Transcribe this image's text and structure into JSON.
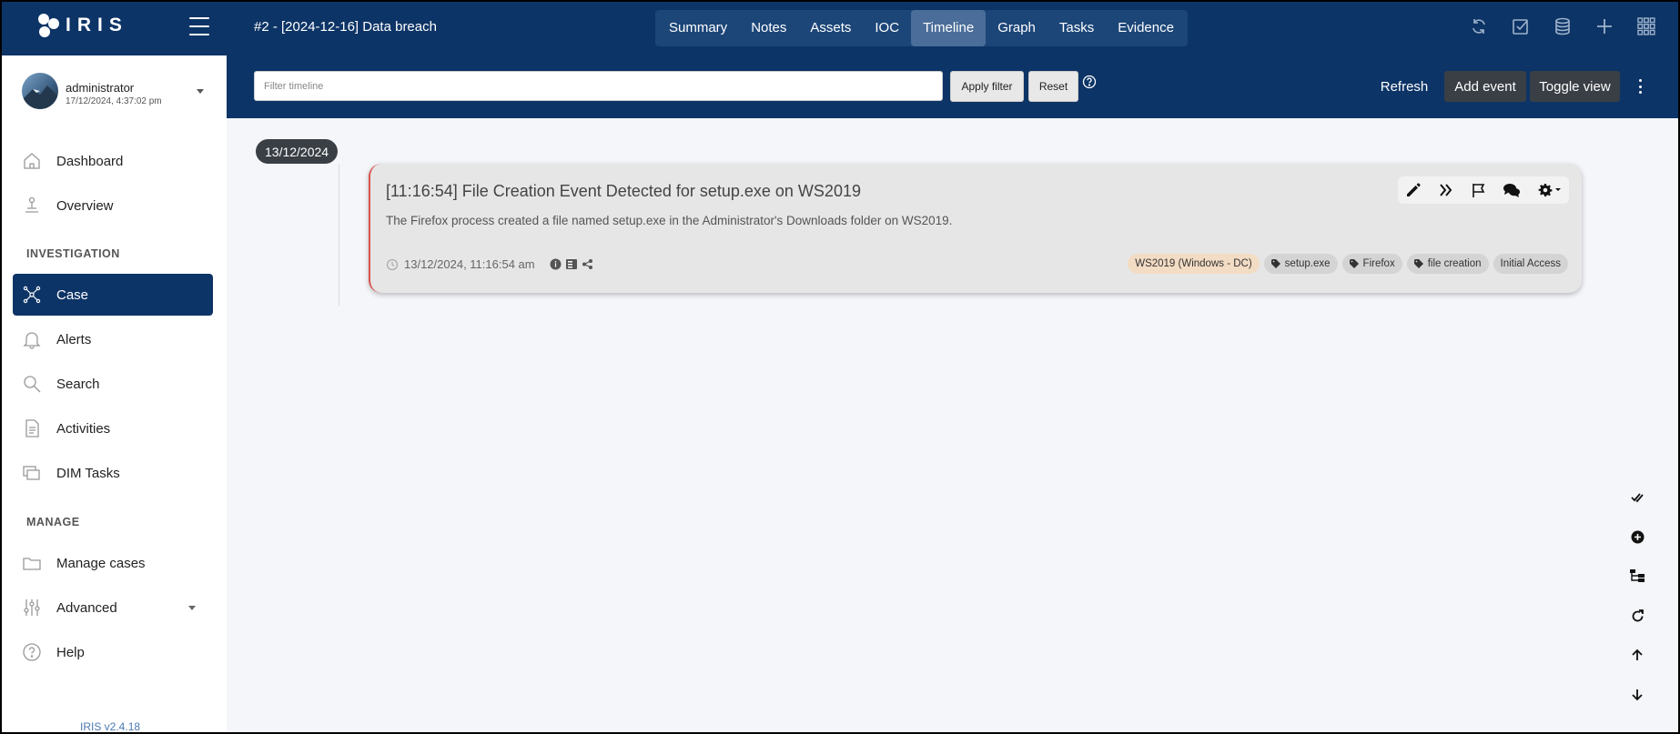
{
  "app": {
    "logo_text": "IRIS",
    "version": "IRIS v2.4.18"
  },
  "header": {
    "case_title": "#2 - [2024-12-16] Data breach",
    "tabs": [
      {
        "label": "Summary"
      },
      {
        "label": "Notes"
      },
      {
        "label": "Assets"
      },
      {
        "label": "IOC"
      },
      {
        "label": "Timeline",
        "active": true
      },
      {
        "label": "Graph"
      },
      {
        "label": "Tasks"
      },
      {
        "label": "Evidence"
      }
    ],
    "icons": [
      "sync-icon",
      "check-square-icon",
      "database-icon",
      "plus-icon",
      "grid-icon"
    ]
  },
  "user": {
    "name": "administrator",
    "last_login": "17/12/2024, 4:37:02 pm"
  },
  "sidebar": {
    "items": [
      {
        "label": "Dashboard",
        "icon": "home-icon"
      },
      {
        "label": "Overview",
        "icon": "overview-icon"
      },
      {
        "label": "Case",
        "icon": "case-network-icon",
        "active": true
      },
      {
        "label": "Alerts",
        "icon": "bell-icon"
      },
      {
        "label": "Search",
        "icon": "search-icon"
      },
      {
        "label": "Activities",
        "icon": "document-icon"
      },
      {
        "label": "DIM Tasks",
        "icon": "windows-icon"
      },
      {
        "label": "Manage cases",
        "icon": "folder-icon"
      },
      {
        "label": "Advanced",
        "icon": "sliders-icon"
      },
      {
        "label": "Help",
        "icon": "help-circle-icon"
      }
    ],
    "sections": {
      "investigation": "INVESTIGATION",
      "manage": "MANAGE"
    }
  },
  "filterbar": {
    "placeholder": "Filter timeline",
    "value": "",
    "apply_label": "Apply filter",
    "reset_label": "Reset",
    "refresh_label": "Refresh",
    "add_event_label": "Add event",
    "toggle_view_label": "Toggle view"
  },
  "timeline": {
    "date": "13/12/2024",
    "events": [
      {
        "title": "[11:16:54] File Creation Event Detected for setup.exe on WS2019",
        "description": "The Firefox process created a file named setup.exe in the Administrator's Downloads folder on WS2019.",
        "datetime": "13/12/2024, 11:16:54 am",
        "asset_tag": "WS2019 (Windows - DC)",
        "tags": [
          "setup.exe",
          "Firefox",
          "file creation"
        ],
        "category": "Initial Access",
        "status_color": "#d9534f"
      }
    ]
  },
  "colors": {
    "navy": "#0d3466",
    "tab_active": "#4a6e99",
    "dark_button": "#3a3f46"
  }
}
